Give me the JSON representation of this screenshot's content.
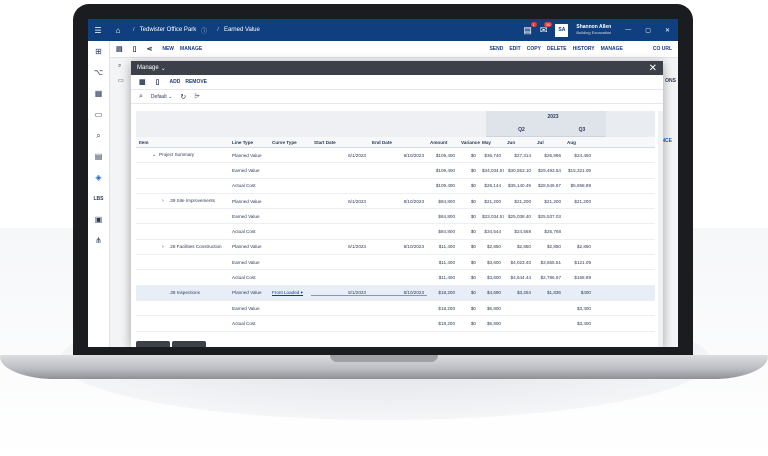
{
  "topbar": {
    "project": "Tedwister Office Park",
    "page": "Earned Value",
    "notif_badge_1": "1",
    "notif_badge_2": "10",
    "avatar": "SA",
    "user_name": "Shannon Allen",
    "user_role": "Building Excavation"
  },
  "toolbar": {
    "new": "NEW",
    "manage": "MANAGE",
    "right": [
      "SEND",
      "EDIT",
      "COPY",
      "DELETE",
      "HISTORY",
      "MANAGE"
    ],
    "co_url": "CO URL"
  },
  "background": {
    "side_label": "ONS",
    "right_link": "NCE"
  },
  "modal": {
    "title": "Manage",
    "add": "ADD",
    "remove": "REMOVE",
    "filter_select": "Default",
    "year": "2023",
    "q2": "Q2",
    "q3": "Q3",
    "columns": [
      "Item",
      "Line Type",
      "Curve Type",
      "Start Date",
      "End Date",
      "Amount",
      "Variance",
      "May",
      "Jun",
      "Jul",
      "Aug",
      ""
    ],
    "rows": [
      {
        "item": "Project Summary",
        "twisty": "⌄",
        "indent": 1,
        "line": "Planned Value",
        "curve": "",
        "start": "6/1/2023",
        "end": "8/10/2023",
        "amount": "$109,400",
        "variance": "$0",
        "may": "$36,740",
        "jun": "$27,314",
        "jul": "$26,896",
        "aug": "$24,450"
      },
      {
        "item": "",
        "twisty": "",
        "indent": 0,
        "line": "Earned Value",
        "curve": "",
        "start": "",
        "end": "",
        "amount": "$109,400",
        "variance": "$0",
        "may": "$34,034.57",
        "jun": "$30,553.10",
        "jul": "$29,493.54",
        "aug": "$15,321.09"
      },
      {
        "item": "",
        "twisty": "",
        "indent": 0,
        "line": "Actual Cost",
        "curve": "",
        "start": "",
        "end": "",
        "amount": "$109,400",
        "variance": "$0",
        "may": "$26,144",
        "jun": "$35,140.49",
        "jul": "$28,546.67",
        "aug": "$5,658.89"
      },
      {
        "item": ".39 Site Improvements",
        "twisty": "›",
        "indent": 2,
        "line": "Planned Value",
        "curve": "",
        "start": "6/1/2023",
        "end": "8/10/2023",
        "amount": "$84,800",
        "variance": "$0",
        "may": "$21,200",
        "jun": "$21,200",
        "jul": "$21,200",
        "aug": "$21,200"
      },
      {
        "item": "",
        "twisty": "",
        "indent": 0,
        "line": "Earned Value",
        "curve": "",
        "start": "",
        "end": "",
        "amount": "$84,800",
        "variance": "$0",
        "may": "$33,034.57",
        "jun": "$25,038.40",
        "jul": "$25,537.03",
        "aug": ""
      },
      {
        "item": "",
        "twisty": "",
        "indent": 0,
        "line": "Actual Cost",
        "curve": "",
        "start": "",
        "end": "",
        "amount": "$84,800",
        "variance": "$0",
        "may": "$34,544",
        "jun": "$24,568",
        "jul": "$25,768",
        "aug": ""
      },
      {
        "item": ".28 Facilities Construction",
        "twisty": "›",
        "indent": 2,
        "line": "Planned Value",
        "curve": "",
        "start": "6/1/2023",
        "end": "8/10/2023",
        "amount": "$11,400",
        "variance": "$0",
        "may": "$2,850",
        "jun": "$2,850",
        "jul": "$2,850",
        "aug": "$2,850"
      },
      {
        "item": "",
        "twisty": "",
        "indent": 0,
        "line": "Earned Value",
        "curve": "",
        "start": "",
        "end": "",
        "amount": "$11,400",
        "variance": "$0",
        "may": "$3,600",
        "jun": "$4,023.40",
        "jul": "$3,555.51",
        "aug": "$121.09"
      },
      {
        "item": "",
        "twisty": "",
        "indent": 0,
        "line": "Actual Cost",
        "curve": "",
        "start": "",
        "end": "",
        "amount": "$11,400",
        "variance": "$0",
        "may": "$3,600",
        "jun": "$4,644.44",
        "jul": "$2,786.67",
        "aug": "$168.89"
      },
      {
        "item": ".38 Inspections",
        "twisty": "",
        "indent": 2,
        "line": "Planned Value",
        "curve": "Front Loaded ▾",
        "start": "5/1/2023",
        "end": "8/10/2023",
        "amount": "$18,200",
        "variance": "$0",
        "may": "$4,690",
        "jun": "$3,254",
        "jul": "$1,836",
        "aug": "$400",
        "selected": true
      },
      {
        "item": "",
        "twisty": "",
        "indent": 0,
        "line": "Earned Value",
        "curve": "",
        "start": "",
        "end": "",
        "amount": "$18,200",
        "variance": "$0",
        "may": "$6,800",
        "jun": "",
        "jul": "",
        "aug": "$3,400"
      },
      {
        "item": "",
        "twisty": "",
        "indent": 0,
        "line": "Actual Cost",
        "curve": "",
        "start": "",
        "end": "",
        "amount": "$18,200",
        "variance": "$0",
        "may": "$6,800",
        "jun": "",
        "jul": "",
        "aug": "$3,400"
      }
    ]
  },
  "colors": {
    "topbar": "#0f3f7e",
    "modal_header": "#3c4048",
    "accent": "#1e62c9"
  }
}
